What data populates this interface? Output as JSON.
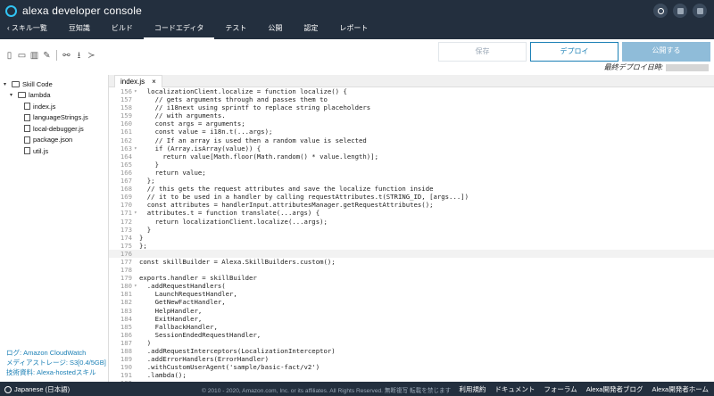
{
  "app": {
    "title": "alexa developer console"
  },
  "nav": {
    "back": "スキル一覧",
    "items": [
      "豆知識",
      "ビルド",
      "コードエディタ",
      "テスト",
      "公開",
      "認定",
      "レポート"
    ],
    "active": "コードエディタ"
  },
  "toolbar": {
    "save": "保存",
    "deploy": "デプロイ",
    "publish": "公開する",
    "last_deploy_label": "最終デプロイ日時:"
  },
  "tree": {
    "root": "Skill Code",
    "folder": "lambda",
    "files": [
      "index.js",
      "languageStrings.js",
      "local-debugger.js",
      "package.json",
      "util.js"
    ]
  },
  "sidebar_links": {
    "log": "ログ: Amazon CloudWatch",
    "media": "メディアストレージ: S3[0.4/5GB]",
    "tech": "技術資料: Alexa-hostedスキル"
  },
  "editor": {
    "tab": "index.js",
    "tab_close": "×"
  },
  "code_lines": [
    {
      "n": "156",
      "f": "▾",
      "t": "  localizationClient.localize = function localize() {"
    },
    {
      "n": "157",
      "f": "",
      "t": "    // gets arguments through and passes them to"
    },
    {
      "n": "158",
      "f": "",
      "t": "    // i18next using sprintf to replace string placeholders"
    },
    {
      "n": "159",
      "f": "",
      "t": "    // with arguments."
    },
    {
      "n": "160",
      "f": "",
      "t": "    const args = arguments;"
    },
    {
      "n": "161",
      "f": "",
      "t": "    const value = i18n.t(...args);"
    },
    {
      "n": "162",
      "f": "",
      "t": "    // If an array is used then a random value is selected"
    },
    {
      "n": "163",
      "f": "▾",
      "t": "    if (Array.isArray(value)) {"
    },
    {
      "n": "164",
      "f": "",
      "t": "      return value[Math.floor(Math.random() * value.length)];"
    },
    {
      "n": "165",
      "f": "",
      "t": "    }"
    },
    {
      "n": "166",
      "f": "",
      "t": "    return value;"
    },
    {
      "n": "167",
      "f": "",
      "t": "  };"
    },
    {
      "n": "168",
      "f": "",
      "t": "  // this gets the request attributes and save the localize function inside"
    },
    {
      "n": "169",
      "f": "",
      "t": "  // it to be used in a handler by calling requestAttributes.t(STRING_ID, [args...])"
    },
    {
      "n": "170",
      "f": "",
      "t": "  const attributes = handlerInput.attributesManager.getRequestAttributes();"
    },
    {
      "n": "171",
      "f": "▾",
      "t": "  attributes.t = function translate(...args) {"
    },
    {
      "n": "172",
      "f": "",
      "t": "    return localizationClient.localize(...args);"
    },
    {
      "n": "173",
      "f": "",
      "t": "  }"
    },
    {
      "n": "174",
      "f": "",
      "t": "}"
    },
    {
      "n": "175",
      "f": "",
      "t": "};"
    },
    {
      "n": "176",
      "f": "",
      "t": ""
    },
    {
      "n": "177",
      "f": "",
      "t": "const skillBuilder = Alexa.SkillBuilders.custom();"
    },
    {
      "n": "178",
      "f": "",
      "t": ""
    },
    {
      "n": "179",
      "f": "",
      "t": "exports.handler = skillBuilder"
    },
    {
      "n": "180",
      "f": "▾",
      "t": "  .addRequestHandlers("
    },
    {
      "n": "181",
      "f": "",
      "t": "    LaunchRequestHandler,"
    },
    {
      "n": "182",
      "f": "",
      "t": "    GetNewFactHandler,"
    },
    {
      "n": "183",
      "f": "",
      "t": "    HelpHandler,"
    },
    {
      "n": "184",
      "f": "",
      "t": "    ExitHandler,"
    },
    {
      "n": "185",
      "f": "",
      "t": "    FallbackHandler,"
    },
    {
      "n": "186",
      "f": "",
      "t": "    SessionEndedRequestHandler,"
    },
    {
      "n": "187",
      "f": "",
      "t": "  )"
    },
    {
      "n": "188",
      "f": "",
      "t": "  .addRequestInterceptors(LocalizationInterceptor)"
    },
    {
      "n": "189",
      "f": "",
      "t": "  .addErrorHandlers(ErrorHandler)"
    },
    {
      "n": "190",
      "f": "",
      "t": "  .withCustomUserAgent('sample/basic-fact/v2')"
    },
    {
      "n": "191",
      "f": "",
      "t": "  .lambda();"
    },
    {
      "n": "192",
      "f": "",
      "t": ""
    }
  ],
  "current_line": "176",
  "footer": {
    "language": "Japanese (日本語)",
    "copyright": "© 2010 - 2020, Amazon.com, Inc. or its affiliates. All Rights Reserved. 無断複写 転載を禁じます",
    "links": [
      "利用規約",
      "ドキュメント",
      "フォーラム",
      "Alexa開発者ブログ",
      "Alexa開発者ホーム"
    ]
  }
}
